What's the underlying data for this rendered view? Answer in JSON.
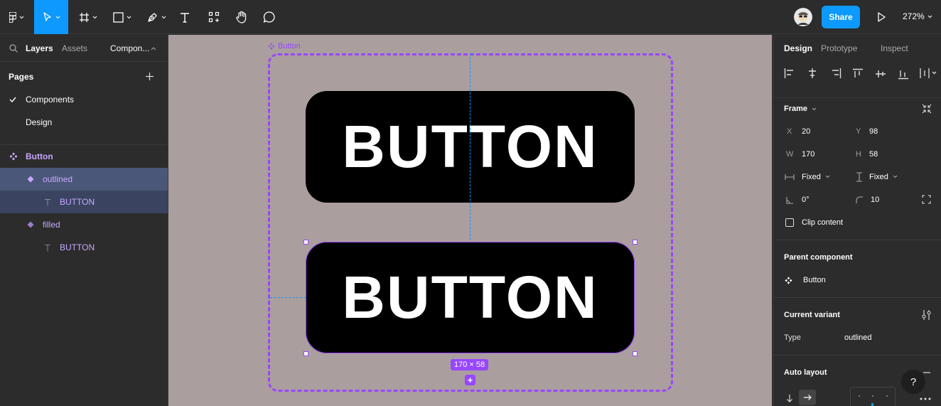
{
  "toolbar": {
    "share_label": "Share",
    "zoom_label": "272%",
    "accent": "#0d99ff"
  },
  "left_panel": {
    "tabs": [
      "Layers",
      "Assets",
      "Compon..."
    ],
    "pages_title": "Pages",
    "pages": [
      {
        "label": "Components",
        "current": true
      },
      {
        "label": "Design",
        "current": false
      }
    ],
    "layers": [
      {
        "label": "Button",
        "icon": "component-set-icon"
      },
      {
        "label": "outlined",
        "icon": "variant-icon"
      },
      {
        "label": "BUTTON",
        "icon": "text-icon"
      },
      {
        "label": "filled",
        "icon": "variant-icon"
      },
      {
        "label": "BUTTON",
        "icon": "text-icon"
      }
    ]
  },
  "canvas": {
    "frame_label": "Button",
    "button_top_text": "BUTTON",
    "button_bottom_text": "BUTTON",
    "size_badge": "170 × 58",
    "plus_badge": "+",
    "selection_color": "#9747ff"
  },
  "right_panel": {
    "tabs": [
      "Design",
      "Prototype",
      "Inspect"
    ],
    "frame_title": "Frame",
    "x_key": "X",
    "x_val": "20",
    "y_key": "Y",
    "y_val": "98",
    "w_key": "W",
    "w_val": "170",
    "h_key": "H",
    "h_val": "58",
    "width_mode": "Fixed",
    "height_mode": "Fixed",
    "rotation": "0°",
    "radius": "10",
    "clip_content": "Clip content",
    "parent_component_title": "Parent component",
    "parent_component": "Button",
    "current_variant_title": "Current variant",
    "variant_prop_key": "Type",
    "variant_prop_val": "outlined",
    "auto_layout_title": "Auto layout",
    "help": "?"
  }
}
